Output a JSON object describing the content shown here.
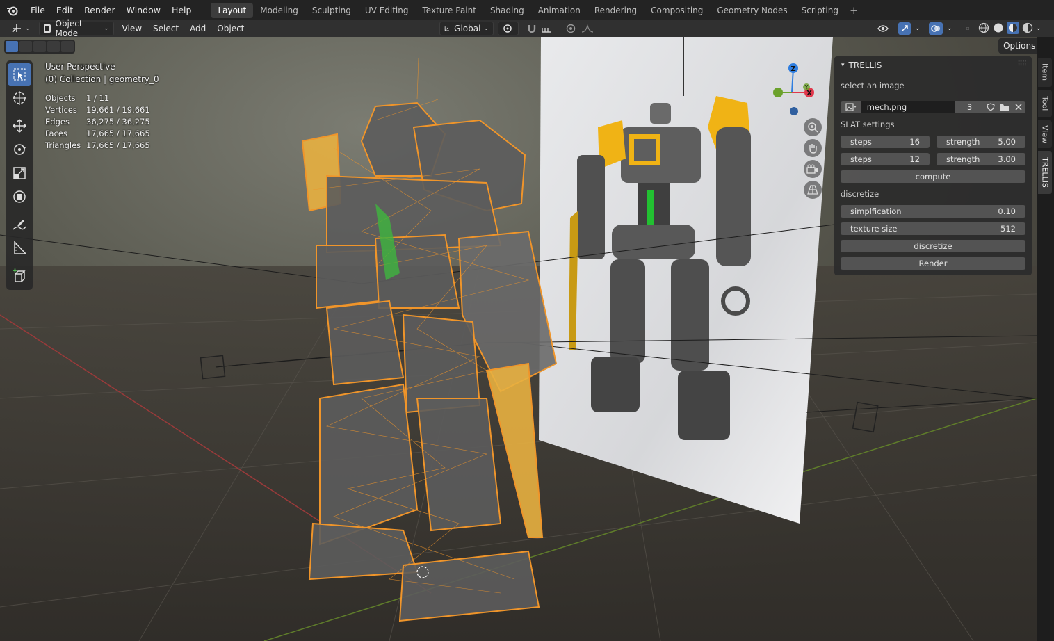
{
  "app": {
    "logo_icon": "blender-logo-icon",
    "menu": [
      "File",
      "Edit",
      "Render",
      "Window",
      "Help"
    ],
    "workspaces": [
      "Layout",
      "Modeling",
      "Sculpting",
      "UV Editing",
      "Texture Paint",
      "Shading",
      "Animation",
      "Rendering",
      "Compositing",
      "Geometry Nodes",
      "Scripting"
    ],
    "active_workspace": "Layout",
    "add_workspace": "+"
  },
  "header": {
    "mode": "Object Mode",
    "menus": [
      "View",
      "Select",
      "Add",
      "Object"
    ],
    "transform_orientation": "Global",
    "options_label": "Options"
  },
  "viewport": {
    "perspective": "User Perspective",
    "collection": "(0) Collection | geometry_0",
    "stats": [
      {
        "label": "Objects",
        "value": "1 / 11"
      },
      {
        "label": "Vertices",
        "value": "19,661 / 19,661"
      },
      {
        "label": "Edges",
        "value": "36,275 / 36,275"
      },
      {
        "label": "Faces",
        "value": "17,665 / 17,665"
      },
      {
        "label": "Triangles",
        "value": "17,665 / 17,665"
      }
    ],
    "gizmo": {
      "z": "Z",
      "x": "X",
      "y": "Y"
    },
    "colors": {
      "x_axis": "#e0384c",
      "y_axis": "#6ba12b",
      "z_axis": "#2f7ee0",
      "selection": "#f0952a"
    }
  },
  "panel": {
    "title": "TRELLIS",
    "select_label": "select an image",
    "image_name": "mech.png",
    "image_users": "3",
    "slat_label": "SLAT settings",
    "row1": {
      "steps_label": "steps",
      "steps_value": "16",
      "strength_label": "strength",
      "strength_value": "5.00"
    },
    "row2": {
      "steps_label": "steps",
      "steps_value": "12",
      "strength_label": "strength",
      "strength_value": "3.00"
    },
    "compute": "compute",
    "discretize_label": "discretize",
    "simplification_label": "simplfication",
    "simplification_value": "0.10",
    "texture_label": "texture size",
    "texture_value": "512",
    "discretize_button": "discretize",
    "render_button": "Render"
  },
  "sidetabs": [
    "Item",
    "Tool",
    "View",
    "TRELLIS"
  ]
}
